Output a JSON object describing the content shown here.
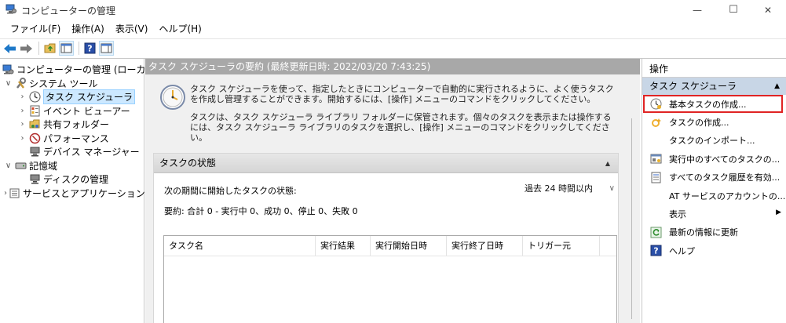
{
  "window": {
    "title": "コンピューターの管理",
    "controls": {
      "minimize": "—",
      "maximize": "☐",
      "close": "✕"
    }
  },
  "menu": [
    "ファイル(F)",
    "操作(A)",
    "表示(V)",
    "ヘルプ(H)"
  ],
  "tree": [
    {
      "label": "コンピューターの管理 (ローカル)",
      "icon": "computer-management-icon",
      "depth": 0,
      "chev": ""
    },
    {
      "label": "システム ツール",
      "icon": "system-tools-icon",
      "depth": 1,
      "chev": "∨"
    },
    {
      "label": "タスク スケジューラ",
      "icon": "task-scheduler-icon",
      "depth": 2,
      "chev": "›",
      "selected": true
    },
    {
      "label": "イベント ビューアー",
      "icon": "event-viewer-icon",
      "depth": 2,
      "chev": "›"
    },
    {
      "label": "共有フォルダー",
      "icon": "shared-folders-icon",
      "depth": 2,
      "chev": "›"
    },
    {
      "label": "パフォーマンス",
      "icon": "performance-icon",
      "depth": 2,
      "chev": "›"
    },
    {
      "label": "デバイス マネージャー",
      "icon": "device-manager-icon",
      "depth": 2,
      "chev": ""
    },
    {
      "label": "記憶域",
      "icon": "storage-icon",
      "depth": 1,
      "chev": "∨"
    },
    {
      "label": "ディスクの管理",
      "icon": "disk-management-icon",
      "depth": 2,
      "chev": ""
    },
    {
      "label": "サービスとアプリケーション",
      "icon": "services-apps-icon",
      "depth": 1,
      "chev": "›"
    }
  ],
  "center": {
    "header": "タスク スケジューラの要約 (最終更新日時: 2022/03/20 7:43:25)",
    "summary_p1": "タスク スケジューラを使って、指定したときにコンピューターで自動的に実行されるように、よく使うタスクを作成し管理することができます。開始するには、[操作] メニューのコマンドをクリックしてください。",
    "summary_p2": "タスクは、タスク スケジューラ ライブラリ フォルダーに保管されます。個々のタスクを表示または操作するには、タスク スケジューラ ライブラリのタスクを選択し、[操作] メニューのコマンドをクリックしてください。",
    "status_title": "タスクの状態",
    "status_label": "次の期間に開始したタスクの状態:",
    "period_value": "過去 24 時間以内",
    "status_summary": "要約: 合計 0 - 実行中 0、成功 0、停止 0、失敗 0",
    "columns": [
      "タスク名",
      "実行結果",
      "実行開始日時",
      "実行終了日時",
      "トリガー元"
    ]
  },
  "actions": {
    "title": "操作",
    "section": "タスク スケジューラ",
    "items": [
      {
        "label": "基本タスクの作成...",
        "icon": "basic-task-icon",
        "highlight": true
      },
      {
        "label": "タスクの作成...",
        "icon": "create-task-icon"
      },
      {
        "label": "タスクのインポート...",
        "icon": ""
      },
      {
        "label": "実行中のすべてのタスクの...",
        "icon": "running-tasks-icon"
      },
      {
        "label": "すべてのタスク履歴を有効...",
        "icon": "history-icon"
      },
      {
        "label": "AT サービスのアカウントの...",
        "icon": ""
      },
      {
        "label": "表示",
        "icon": "",
        "submenu": true
      },
      {
        "label": "最新の情報に更新",
        "icon": "refresh-icon"
      },
      {
        "label": "ヘルプ",
        "icon": "help-icon"
      }
    ]
  },
  "colors": {
    "selection_bg": "#cce8ff",
    "header_gray": "#a8a8a8",
    "actions_section": "#c8d6e6",
    "highlight_red": "#e02424",
    "back_arrow_blue": "#1e78c8"
  }
}
